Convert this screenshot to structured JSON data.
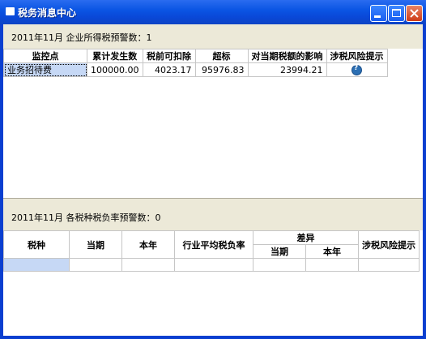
{
  "window": {
    "title": "税务消息中心"
  },
  "section1": {
    "caption": "2011年11月 企业所得税预警数：1",
    "columns": [
      "监控点",
      "累计发生数",
      "税前可扣除",
      "超标",
      "对当期税额的影响",
      "涉税风险提示"
    ],
    "rows": [
      {
        "name": "业务招待费",
        "cumulative": "100000.00",
        "deductible": "4023.17",
        "excess": "95976.83",
        "impact": "23994.21",
        "risk_icon": "help-icon"
      }
    ]
  },
  "section2": {
    "caption": "2011年11月 各税种税负率预警数：0",
    "columns": {
      "tax": "税种",
      "current": "当期",
      "year": "本年",
      "industry": "行业平均税负率",
      "diff": "差异",
      "diff_current": "当期",
      "diff_year": "本年",
      "risk": "涉税风险提示"
    }
  }
}
